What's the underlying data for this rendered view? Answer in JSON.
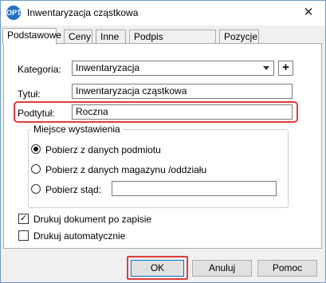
{
  "window": {
    "title": "Inwentaryzacja cząstkowa",
    "app_icon_text": "OPT"
  },
  "tabs": [
    {
      "label": "Podstawowe"
    },
    {
      "label": "Ceny"
    },
    {
      "label": "Inne"
    },
    {
      "label": "Podpis elektroniczny"
    },
    {
      "label": "Pozycje"
    }
  ],
  "form": {
    "kategoria_label": "Kategoria:",
    "kategoria_value": "Inwentaryzacja",
    "plus_label": "+",
    "tytul_label": "Tytuł:",
    "tytul_value": "Inwentaryzacja cząstkowa",
    "podtytul_label": "Podtytuł:",
    "podtytul_value": "Roczna"
  },
  "issue_place": {
    "title": "Miejsce wystawienia",
    "options": [
      {
        "label": "Pobierz z danych podmiotu",
        "selected": true
      },
      {
        "label": "Pobierz z danych magazynu /oddziału",
        "selected": false
      },
      {
        "label": "Pobierz stąd:",
        "selected": false
      }
    ],
    "custom_value": ""
  },
  "checkboxes": [
    {
      "label": "Drukuj dokument po zapisie",
      "checked": true
    },
    {
      "label": "Drukuj automatycznie",
      "checked": false
    }
  ],
  "buttons": {
    "ok": "OK",
    "cancel": "Anuluj",
    "help": "Pomoc"
  },
  "colors": {
    "highlight": "#e03c3c",
    "accent": "#0078d7"
  }
}
